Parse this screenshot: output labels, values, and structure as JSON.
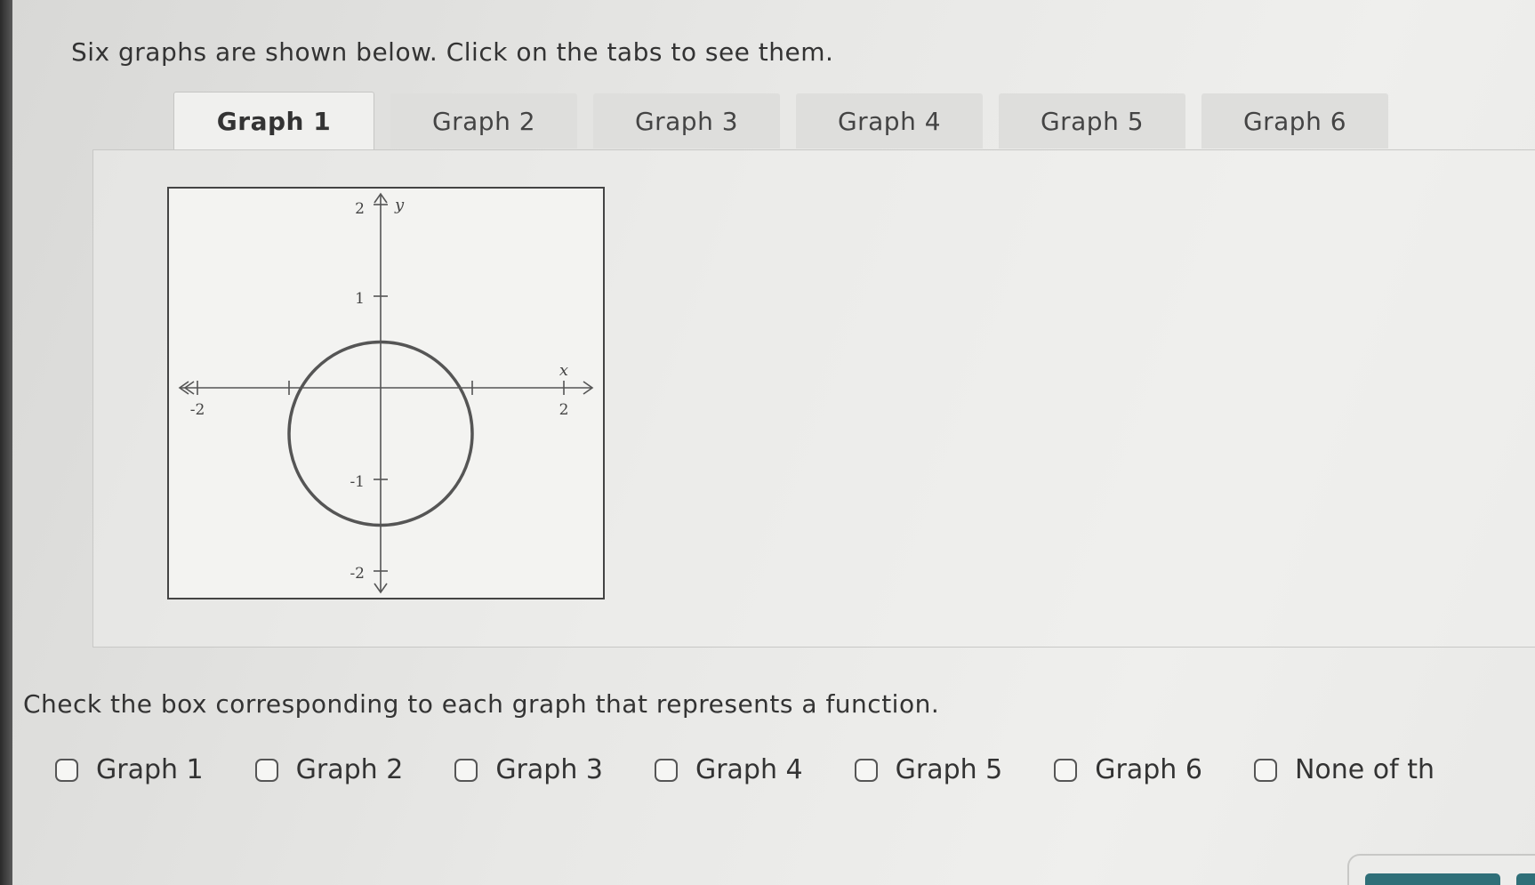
{
  "intro_text": "Six graphs are shown below. Click on the tabs to see them.",
  "tabs": [
    {
      "label": "Graph 1",
      "active": true
    },
    {
      "label": "Graph 2",
      "active": false
    },
    {
      "label": "Graph 3",
      "active": false
    },
    {
      "label": "Graph 4",
      "active": false
    },
    {
      "label": "Graph 5",
      "active": false
    },
    {
      "label": "Graph 6",
      "active": false
    }
  ],
  "graph": {
    "y_label": "y",
    "x_label": "x",
    "ticks": {
      "y_top": "2",
      "y_one": "1",
      "y_neg_one": "-1",
      "y_bottom": "-2",
      "x_left": "-2",
      "x_right": "2"
    },
    "x_range": [
      -2,
      2
    ],
    "y_range": [
      -2,
      2
    ],
    "shape": "circle",
    "circle_center": [
      0,
      -0.5
    ],
    "circle_radius": 1
  },
  "question_text": "Check the box corresponding to each graph that represents a function.",
  "options": [
    {
      "label": "Graph 1",
      "checked": false
    },
    {
      "label": "Graph 2",
      "checked": false
    },
    {
      "label": "Graph 3",
      "checked": false
    },
    {
      "label": "Graph 4",
      "checked": false
    },
    {
      "label": "Graph 5",
      "checked": false
    },
    {
      "label": "Graph 6",
      "checked": false
    },
    {
      "label": "None of th",
      "checked": false
    }
  ],
  "colors": {
    "accent": "#2f6f78",
    "curve": "#555555"
  }
}
